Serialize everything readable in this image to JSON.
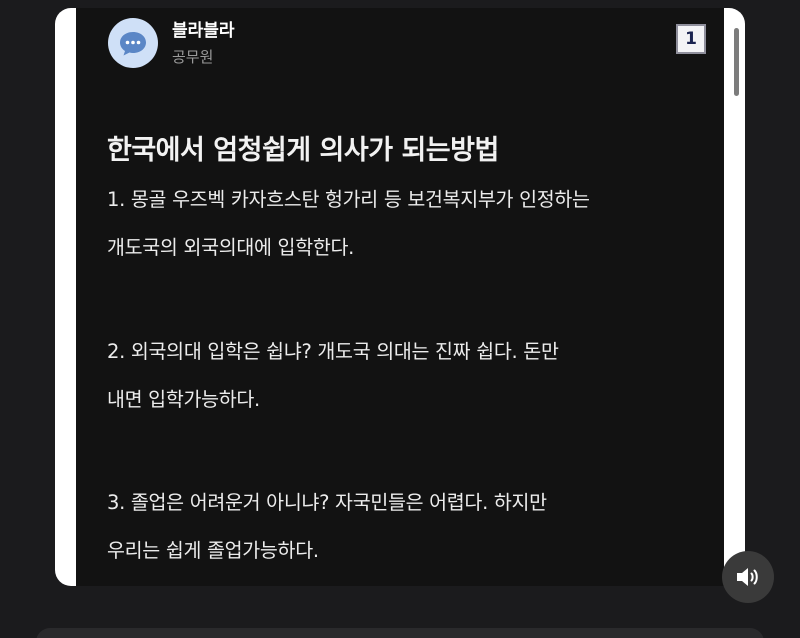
{
  "post": {
    "author_name": "블라블라",
    "author_job": "공무원",
    "page_number": "1",
    "title": "한국에서 엄청쉽게 의사가 되는방법",
    "paragraphs": [
      {
        "line1": "1. 몽골 우즈벡 카자흐스탄 헝가리 등 보건복지부가 인정하는",
        "line2": "개도국의 외국의대에 입학한다."
      },
      {
        "line1": "2. 외국의대 입학은 쉽냐? 개도국 의대는 진짜 쉽다. 돈만",
        "line2": "내면 입학가능하다."
      },
      {
        "line1": "3. 졸업은 어려운거 아니냐? 자국민들은 어렵다. 하지만",
        "line2": "우리는 쉽게 졸업가능하다."
      }
    ]
  },
  "icons": {
    "avatar": "chat-bubble-icon",
    "sound": "speaker-icon"
  },
  "colors": {
    "card_background": "#121212",
    "avatar_background": "#cfe0f7",
    "avatar_bubble": "#3f6fb3",
    "frame": "#ffffff"
  }
}
